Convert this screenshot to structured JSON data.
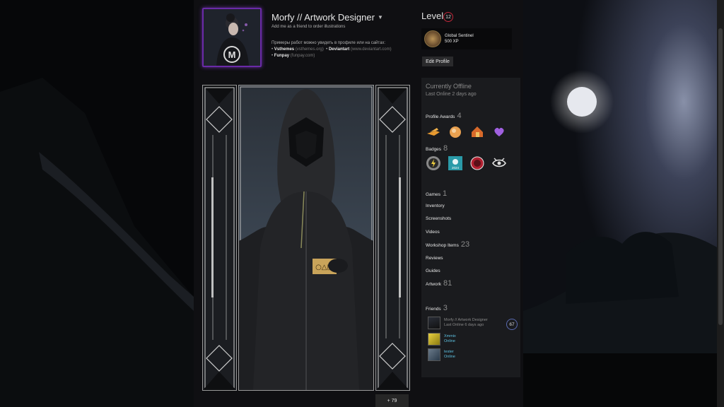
{
  "profile": {
    "persona_name": "Morfy // Artwork Designer",
    "summary": {
      "line1": "Add me as a friend to order illustrations",
      "line2": "Примеры работ можно увидеть в профиле или на сайтах:",
      "links": [
        {
          "name": "Vsthemes",
          "domain": "(vsthemes.org)"
        },
        {
          "name": "Deviantart",
          "domain": "(www.deviantart.com)"
        },
        {
          "name": "Funpay",
          "domain": "(funpay.com)"
        }
      ]
    },
    "level_label": "Level",
    "level_value": "12",
    "featured_badge": {
      "name": "Global Sentinel",
      "xp": "500 XP"
    },
    "edit_button": "Edit Profile"
  },
  "showcase": {
    "more_label": "+ 79",
    "tag_symbols": "○△□"
  },
  "sidebar": {
    "status": "Currently Offline",
    "last_online": "Last Online 2 days ago",
    "profile_awards": {
      "label": "Profile Awards",
      "count": "4"
    },
    "badges": {
      "label": "Badges",
      "count": "8",
      "year_text": "2024"
    },
    "links": [
      {
        "label": "Games",
        "count": "1"
      },
      {
        "label": "Inventory",
        "count": ""
      },
      {
        "label": "Screenshots",
        "count": ""
      },
      {
        "label": "Videos",
        "count": ""
      },
      {
        "label": "Workshop Items",
        "count": "23"
      },
      {
        "label": "Reviews",
        "count": ""
      },
      {
        "label": "Guides",
        "count": ""
      },
      {
        "label": "Artwork",
        "count": "81"
      }
    ],
    "friends": {
      "label": "Friends",
      "count": "3",
      "items": [
        {
          "name": "Morfy // Artwork Designer",
          "status": "Last Online 6 days ago",
          "level": "67"
        },
        {
          "name": "Xmmix",
          "status": "Online"
        },
        {
          "name": "tester",
          "status": "Online"
        }
      ]
    }
  },
  "colors": {
    "online": "#5dc0e0",
    "level_ring": "#c0283a",
    "avatar_ring": "#6a2aa8"
  }
}
